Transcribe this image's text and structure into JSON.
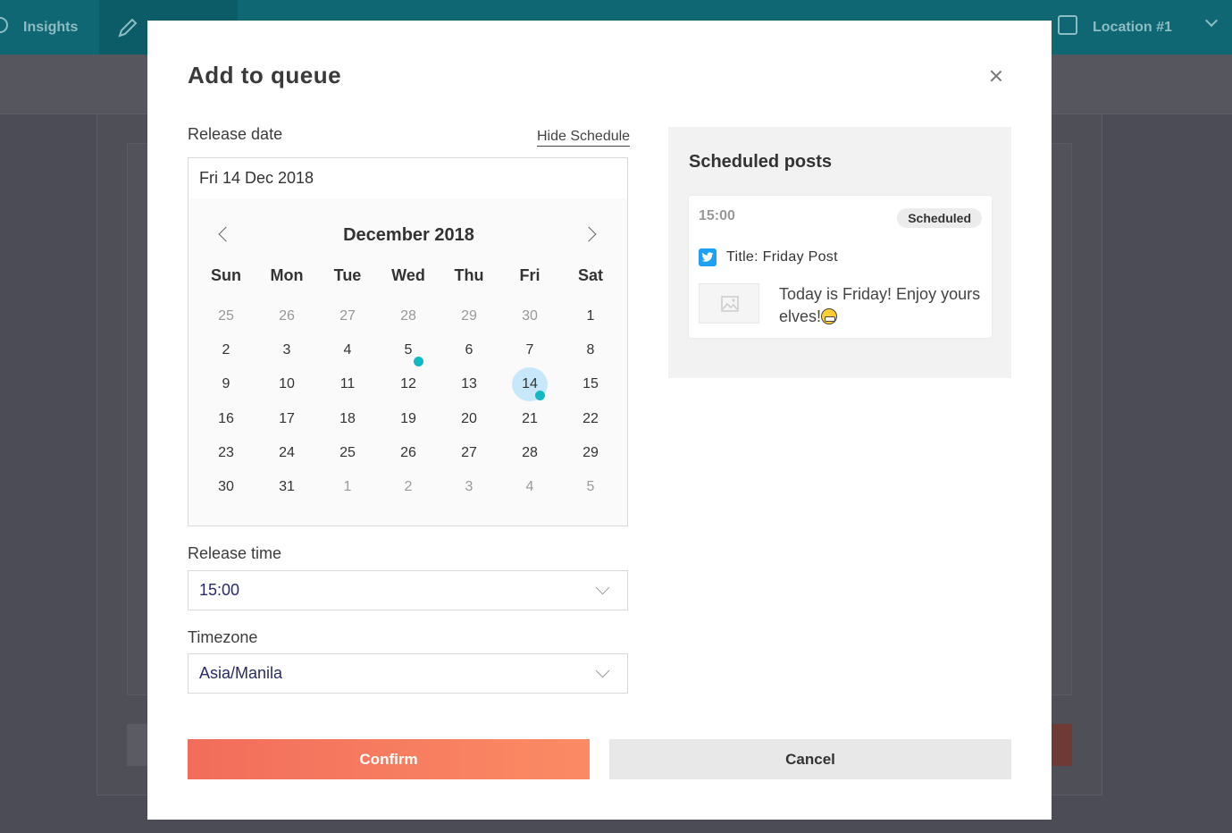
{
  "app": {
    "nav": {
      "insights": "Insights",
      "location": "Location #1"
    }
  },
  "modal": {
    "title": "Add to queue",
    "release_date_label": "Release date",
    "hide_schedule": "Hide Schedule",
    "date_value": "Fri 14 Dec 2018",
    "calendar": {
      "month": "December 2018",
      "weekdays": [
        "Sun",
        "Mon",
        "Tue",
        "Wed",
        "Thu",
        "Fri",
        "Sat"
      ],
      "weeks": [
        [
          {
            "d": "25",
            "m": true
          },
          {
            "d": "26",
            "m": true
          },
          {
            "d": "27",
            "m": true
          },
          {
            "d": "28",
            "m": true
          },
          {
            "d": "29",
            "m": true
          },
          {
            "d": "30",
            "m": true
          },
          {
            "d": "1"
          }
        ],
        [
          {
            "d": "2"
          },
          {
            "d": "3"
          },
          {
            "d": "4"
          },
          {
            "d": "5",
            "dot": true
          },
          {
            "d": "6"
          },
          {
            "d": "7"
          },
          {
            "d": "8"
          }
        ],
        [
          {
            "d": "9"
          },
          {
            "d": "10"
          },
          {
            "d": "11"
          },
          {
            "d": "12"
          },
          {
            "d": "13"
          },
          {
            "d": "14",
            "sel": true,
            "dot": true
          },
          {
            "d": "15"
          }
        ],
        [
          {
            "d": "16"
          },
          {
            "d": "17"
          },
          {
            "d": "18"
          },
          {
            "d": "19"
          },
          {
            "d": "20"
          },
          {
            "d": "21"
          },
          {
            "d": "22"
          }
        ],
        [
          {
            "d": "23"
          },
          {
            "d": "24"
          },
          {
            "d": "25"
          },
          {
            "d": "26"
          },
          {
            "d": "27"
          },
          {
            "d": "28"
          },
          {
            "d": "29"
          }
        ],
        [
          {
            "d": "30"
          },
          {
            "d": "31"
          },
          {
            "d": "1",
            "m": true
          },
          {
            "d": "2",
            "m": true
          },
          {
            "d": "3",
            "m": true
          },
          {
            "d": "4",
            "m": true
          },
          {
            "d": "5",
            "m": true
          }
        ]
      ]
    },
    "release_time_label": "Release time",
    "release_time_value": "15:00",
    "timezone_label": "Timezone",
    "timezone_value": "Asia/Manila",
    "confirm": "Confirm",
    "cancel": "Cancel",
    "scheduled": {
      "title": "Scheduled posts",
      "post": {
        "time": "15:00",
        "status": "Scheduled",
        "title": "Title: Friday Post",
        "text": "Today is Friday! Enjoy yours elves!",
        "emoji": "grinning-face"
      }
    }
  },
  "colors": {
    "accent_dot": "#12b9c4",
    "selected_day": "#c7e8fb",
    "confirm_start": "#f26d5b",
    "confirm_end": "#fb8b64",
    "topbar": "#0e6772",
    "twitter": "#1da1f2"
  }
}
